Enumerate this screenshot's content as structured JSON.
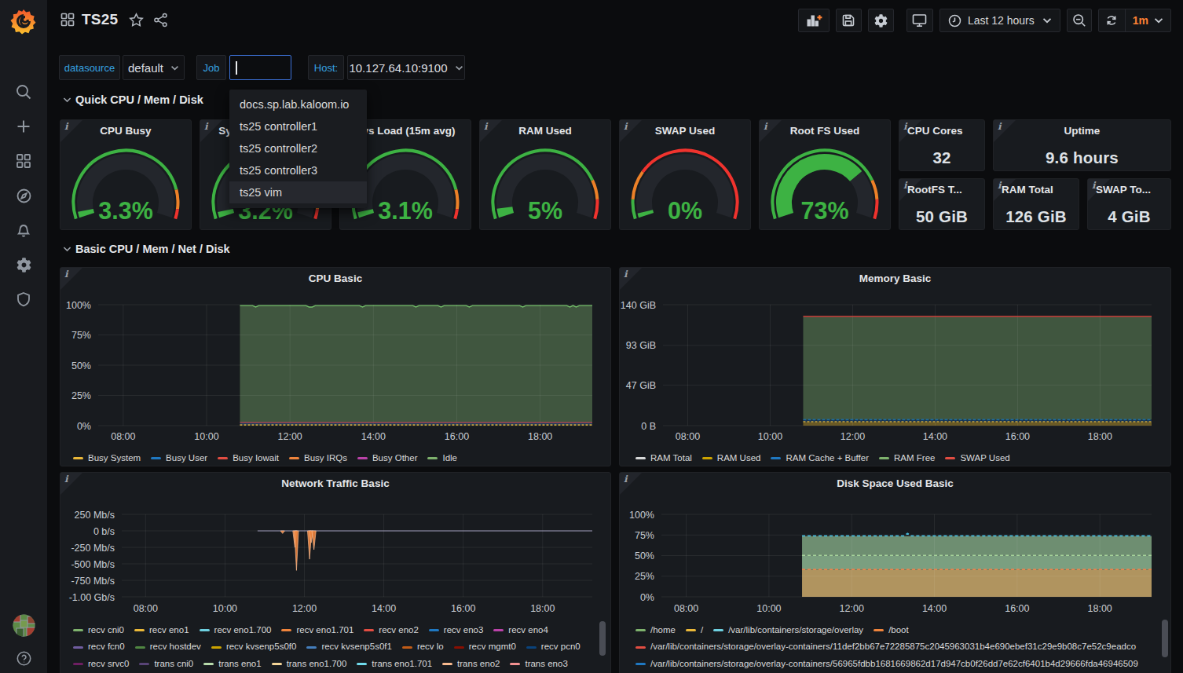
{
  "header": {
    "title": "TS25",
    "time_range": "Last 12 hours",
    "refresh_interval": "1m"
  },
  "sidebar": {
    "icons": [
      "search",
      "add",
      "dashboards",
      "explore",
      "alerting",
      "configuration",
      "server-admin",
      "avatar",
      "help"
    ]
  },
  "variables": {
    "datasource_label": "datasource",
    "datasource_value": "default",
    "job_label": "Job",
    "job_value": "",
    "host_label": "Host:",
    "host_value": "10.127.64.10:9100"
  },
  "job_dropdown": {
    "options": [
      "docs.sp.lab.kaloom.io",
      "ts25 controller1",
      "ts25 controller2",
      "ts25 controller3",
      "ts25 vim"
    ],
    "highlighted": "ts25 vim"
  },
  "rows": [
    {
      "title": "Quick CPU / Mem / Disk"
    },
    {
      "title": "Basic CPU / Mem / Net / Disk"
    }
  ],
  "colors": {
    "gauge_green": "#3db243",
    "gauge_orange": "#ed8128",
    "gauge_red": "#f0332e",
    "track": "#23262c",
    "grid": "#24262a",
    "axis_text": "#c9cdd3",
    "accent_blue": "#36a2e0",
    "accent_orange": "#ff8033"
  },
  "gauges": [
    {
      "title": "CPU Busy",
      "value_text": "3.3%",
      "value": 0.033,
      "thresholds": [
        0.85,
        0.95
      ]
    },
    {
      "title": "Sys Load (5m avg)",
      "value_text": "3.2%",
      "value": 0.032,
      "thresholds": [
        0.85,
        0.95
      ]
    },
    {
      "title": "Sys Load (15m avg)",
      "value_text": "3.1%",
      "value": 0.031,
      "thresholds": [
        0.85,
        0.95
      ]
    },
    {
      "title": "RAM Used",
      "value_text": "5%",
      "value": 0.05,
      "thresholds": [
        0.8,
        0.9
      ]
    },
    {
      "title": "SWAP Used",
      "value_text": "0%",
      "value": 0.004,
      "thresholds": [
        0.1,
        0.25
      ]
    },
    {
      "title": "Root FS Used",
      "value_text": "73%",
      "value": 0.73,
      "thresholds": [
        0.8,
        0.9
      ]
    }
  ],
  "stats": [
    {
      "title": "CPU Cores",
      "value": "32"
    },
    {
      "title": "Uptime",
      "value": "9.6 hours"
    },
    {
      "title": "RootFS T...",
      "value": "50 GiB"
    },
    {
      "title": "RAM Total",
      "value": "126 GiB"
    },
    {
      "title": "SWAP To...",
      "value": "4 GiB"
    }
  ],
  "chart_data": [
    {
      "type": "area",
      "title": "CPU Basic",
      "stacked": true,
      "x_range": [
        7.4,
        19.25
      ],
      "data_start": 10.8,
      "x_ticks": [
        {
          "label": "08:00",
          "h": 8
        },
        {
          "label": "10:00",
          "h": 10
        },
        {
          "label": "12:00",
          "h": 12
        },
        {
          "label": "14:00",
          "h": 14
        },
        {
          "label": "16:00",
          "h": 16
        },
        {
          "label": "18:00",
          "h": 18
        }
      ],
      "y_range": [
        0,
        100
      ],
      "y_ticks": [
        {
          "label": "100%",
          "v": 100
        },
        {
          "label": "75%",
          "v": 75
        },
        {
          "label": "50%",
          "v": 50
        },
        {
          "label": "25%",
          "v": 25
        },
        {
          "label": "0%",
          "v": 0
        }
      ],
      "layers": [
        {
          "name": "Busy User",
          "color": "#1C3A5E",
          "from": 0.7,
          "to": 2.1
        },
        {
          "name": "Idle",
          "color": "#40563F",
          "from": 3.0,
          "to": 99.3,
          "top_line": "#73BF69",
          "noisy_top": true
        }
      ],
      "lines": [
        {
          "name": "Busy System",
          "v": 0.55,
          "color": "#C9A53E",
          "w": 1.6,
          "dash": "3,2"
        },
        {
          "name": "Busy Iowait",
          "v": 2.55,
          "color": "#A84F5C",
          "w": 1.6
        }
      ],
      "legend_rows": [
        [
          {
            "label": "Busy System",
            "color": "#EAB839"
          },
          {
            "label": "Busy User",
            "color": "#1F78C1"
          },
          {
            "label": "Busy Iowait",
            "color": "#E24D42"
          },
          {
            "label": "Busy IRQs",
            "color": "#EF843C"
          },
          {
            "label": "Busy Other",
            "color": "#BA43A9"
          },
          {
            "label": "Idle",
            "color": "#7EB26D"
          }
        ]
      ]
    },
    {
      "type": "area",
      "title": "Memory Basic",
      "stacked": true,
      "x_range": [
        7.4,
        19.25
      ],
      "data_start": 10.8,
      "x_ticks": [
        {
          "label": "08:00",
          "h": 8
        },
        {
          "label": "10:00",
          "h": 10
        },
        {
          "label": "12:00",
          "h": 12
        },
        {
          "label": "14:00",
          "h": 14
        },
        {
          "label": "16:00",
          "h": 16
        },
        {
          "label": "18:00",
          "h": 18
        }
      ],
      "y_range": [
        0,
        140
      ],
      "y_ticks": [
        {
          "label": "140 GiB",
          "v": 140
        },
        {
          "label": "93 GiB",
          "v": 93
        },
        {
          "label": "47 GiB",
          "v": 47
        },
        {
          "label": "0 B",
          "v": 0
        }
      ],
      "layers": [
        {
          "name": "RAM Used",
          "color": "#6A5A25",
          "from": 0,
          "to": 4.3
        },
        {
          "name": "RAM Cache + Buffer",
          "color": "#16314E",
          "from": 4.3,
          "to": 6.6
        },
        {
          "name": "RAM Free",
          "color": "#40563F",
          "from": 6.9,
          "to": 125.8
        }
      ],
      "lines": [
        {
          "name": "RAM Used",
          "v": 4.5,
          "color": "#C9A53E",
          "w": 1.4,
          "dash": "3,2"
        },
        {
          "name": "RAM Cache + Buffer",
          "v": 6.9,
          "color": "#1C699C",
          "w": 1.6,
          "dash": "4,2"
        },
        {
          "name": "SWAP Used",
          "v": 126.3,
          "color": "#D0493F",
          "w": 1.6
        }
      ],
      "legend_rows": [
        [
          {
            "label": "RAM Total",
            "color": "#D8D9DA"
          },
          {
            "label": "RAM Used",
            "color": "#CCA300"
          },
          {
            "label": "RAM Cache + Buffer",
            "color": "#1F78C1"
          },
          {
            "label": "RAM Free",
            "color": "#7EB26D"
          },
          {
            "label": "SWAP Used",
            "color": "#E24D42"
          }
        ]
      ]
    },
    {
      "type": "line",
      "title": "Network Traffic Basic",
      "x_range": [
        7.4,
        19.25
      ],
      "data_start": 10.82,
      "x_ticks": [
        {
          "label": "08:00",
          "h": 8
        },
        {
          "label": "10:00",
          "h": 10
        },
        {
          "label": "12:00",
          "h": 12
        },
        {
          "label": "14:00",
          "h": 14
        },
        {
          "label": "16:00",
          "h": 16
        },
        {
          "label": "18:00",
          "h": 18
        }
      ],
      "y_range": [
        -1000,
        250
      ],
      "y_ticks": [
        {
          "label": "250 Mb/s",
          "v": 250
        },
        {
          "label": "0 b/s",
          "v": 0
        },
        {
          "label": "-250 Mb/s",
          "v": -250
        },
        {
          "label": "-500 Mb/s",
          "v": -500
        },
        {
          "label": "-750 Mb/s",
          "v": -750
        },
        {
          "label": "-1.00 Gb/s",
          "v": -1000
        }
      ],
      "baseline": {
        "v": 0,
        "color": "#9a97b5",
        "w": 1.2
      },
      "spikes": [
        {
          "h": 11.76,
          "v": -250
        },
        {
          "h": 11.8,
          "v": -600
        },
        {
          "h": 12.13,
          "v": -430
        },
        {
          "h": 12.17,
          "v": -180
        },
        {
          "h": 12.24,
          "v": -285
        },
        {
          "h": 11.45,
          "v": -40
        }
      ],
      "spike_color": "#EF843C",
      "legend_scroll": true,
      "legend_rows": [
        [
          {
            "label": "recv cni0",
            "color": "#7EB26D"
          },
          {
            "label": "recv eno1",
            "color": "#EAB839"
          },
          {
            "label": "recv eno1.700",
            "color": "#6ED0E0"
          },
          {
            "label": "recv eno1.701",
            "color": "#EF843C"
          },
          {
            "label": "recv eno2",
            "color": "#E24D42"
          },
          {
            "label": "recv eno3",
            "color": "#1F78C1"
          },
          {
            "label": "recv eno4",
            "color": "#BA43A9"
          }
        ],
        [
          {
            "label": "recv fcn0",
            "color": "#705DA0"
          },
          {
            "label": "recv hostdev",
            "color": "#508642"
          },
          {
            "label": "recv kvsenp5s0f0",
            "color": "#CCA300"
          },
          {
            "label": "recv kvsenp5s0f1",
            "color": "#447EBC"
          },
          {
            "label": "recv lo",
            "color": "#C15C17"
          },
          {
            "label": "recv mgmt0",
            "color": "#890F02"
          },
          {
            "label": "recv pcn0",
            "color": "#0A437C"
          }
        ],
        [
          {
            "label": "recv srvc0",
            "color": "#6D1F62"
          },
          {
            "label": "trans cni0",
            "color": "#584477"
          },
          {
            "label": "trans eno1",
            "color": "#B7DBAB"
          },
          {
            "label": "trans eno1.700",
            "color": "#F4D598"
          },
          {
            "label": "trans eno1.701",
            "color": "#70DBED"
          },
          {
            "label": "trans eno2",
            "color": "#F9BA8F"
          },
          {
            "label": "trans eno3",
            "color": "#F29191"
          }
        ]
      ]
    },
    {
      "type": "area",
      "title": "Disk Space Used Basic",
      "stacked": false,
      "x_range": [
        7.4,
        19.25
      ],
      "data_start": 10.8,
      "x_ticks": [
        {
          "label": "08:00",
          "h": 8
        },
        {
          "label": "10:00",
          "h": 10
        },
        {
          "label": "12:00",
          "h": 12
        },
        {
          "label": "14:00",
          "h": 14
        },
        {
          "label": "16:00",
          "h": 16
        },
        {
          "label": "18:00",
          "h": 18
        }
      ],
      "y_range": [
        0,
        100
      ],
      "y_ticks": [
        {
          "label": "100%",
          "v": 100
        },
        {
          "label": "75%",
          "v": 75
        },
        {
          "label": "50%",
          "v": 50
        },
        {
          "label": "25%",
          "v": 25
        },
        {
          "label": "0%",
          "v": 0
        }
      ],
      "layers": [
        {
          "name": "overlay",
          "color": "#6E8E71",
          "from": 50,
          "to": 73.6
        },
        {
          "name": "home",
          "color": "#7B9F80",
          "from": 33,
          "to": 50
        },
        {
          "name": "root",
          "color": "#B0945F",
          "from": 0,
          "to": 33
        }
      ],
      "lines": [
        {
          "name": "overlay",
          "v": 73.9,
          "color": "#45B6D6",
          "w": 1.8,
          "dash": "4,3",
          "bump": {
            "h": 13.35,
            "dv": 3
          }
        },
        {
          "name": "home",
          "v": 50.2,
          "color": "#A7D49B",
          "w": 1.4,
          "dash": "4,3"
        },
        {
          "name": "boot",
          "v": 33.3,
          "color": "#E8834E",
          "w": 1.8,
          "dash": "4,3"
        }
      ],
      "legend_scroll": true,
      "legend_rows": [
        [
          {
            "label": "/home",
            "color": "#7EB26D"
          },
          {
            "label": "/",
            "color": "#EAB839"
          },
          {
            "label": "/var/lib/containers/storage/overlay",
            "color": "#6ED0E0"
          },
          {
            "label": "/boot",
            "color": "#EF843C"
          }
        ],
        [
          {
            "label": "/var/lib/containers/storage/overlay-containers/11def2bb67e72285875c2045963031b4e690ebef31c29e9b08c7e52c9eadco",
            "color": "#E24D42"
          }
        ],
        [
          {
            "label": "/var/lib/containers/storage/overlay-containers/56965fdbb1681669862d17d947cb0f26dd7e62cf6401b4d29666fda46946509",
            "color": "#1F78C1"
          }
        ]
      ]
    }
  ]
}
